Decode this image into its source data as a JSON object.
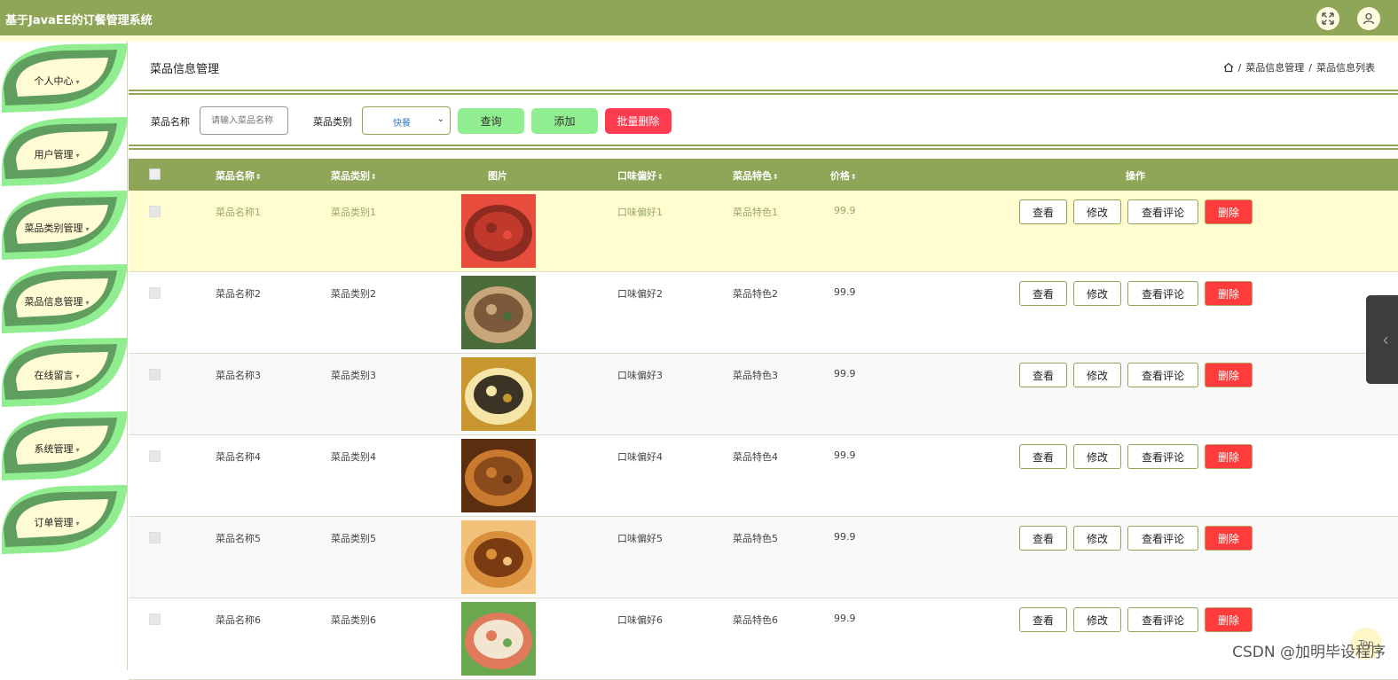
{
  "app": {
    "title": "基于JavaEE的订餐管理系统",
    "colors": {
      "primary": "#8fa659",
      "highlight_row": "#fffdd0",
      "button_green": "#90ee90",
      "button_red": "#ff3b50"
    }
  },
  "header_icons": [
    "fullscreen-icon",
    "user-icon"
  ],
  "sidebar": {
    "items": [
      {
        "label": "个人中心"
      },
      {
        "label": "用户管理"
      },
      {
        "label": "菜品类别管理"
      },
      {
        "label": "菜品信息管理"
      },
      {
        "label": "在线留言"
      },
      {
        "label": "系统管理"
      },
      {
        "label": "订单管理"
      }
    ]
  },
  "page": {
    "title": "菜品信息管理",
    "breadcrumb": [
      "菜品信息管理",
      "菜品信息列表"
    ]
  },
  "filter": {
    "name_label": "菜品名称",
    "name_placeholder": "请输入菜品名称",
    "category_label": "菜品类别",
    "category_value": "快餐",
    "search_label": "查询",
    "add_label": "添加",
    "batch_delete_label": "批量删除"
  },
  "table": {
    "columns": [
      "菜品名称",
      "菜品类别",
      "图片",
      "口味偏好",
      "菜品特色",
      "价格",
      "操作"
    ],
    "actions": {
      "view": "查看",
      "edit": "修改",
      "comments": "查看评论",
      "delete": "删除"
    },
    "rows": [
      {
        "name": "菜品名称1",
        "category": "菜品类别1",
        "taste": "口味偏好1",
        "feature": "菜品特色1",
        "price": "99.9"
      },
      {
        "name": "菜品名称2",
        "category": "菜品类别2",
        "taste": "口味偏好2",
        "feature": "菜品特色2",
        "price": "99.9"
      },
      {
        "name": "菜品名称3",
        "category": "菜品类别3",
        "taste": "口味偏好3",
        "feature": "菜品特色3",
        "price": "99.9"
      },
      {
        "name": "菜品名称4",
        "category": "菜品类别4",
        "taste": "口味偏好4",
        "feature": "菜品特色4",
        "price": "99.9"
      },
      {
        "name": "菜品名称5",
        "category": "菜品类别5",
        "taste": "口味偏好5",
        "feature": "菜品特色5",
        "price": "99.9"
      },
      {
        "name": "菜品名称6",
        "category": "菜品类别6",
        "taste": "口味偏好6",
        "feature": "菜品特色6",
        "price": "99.9"
      }
    ]
  },
  "watermark": "CSDN @加明毕设程序",
  "back_to_top": "Top"
}
